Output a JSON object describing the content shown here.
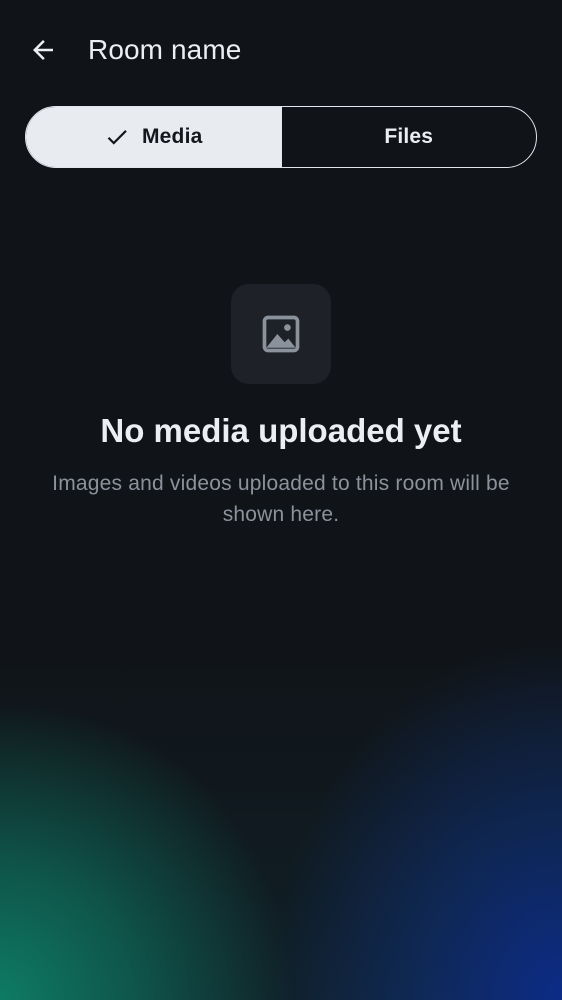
{
  "header": {
    "title": "Room name",
    "back_icon": "arrow-left-icon"
  },
  "tabs": [
    {
      "label": "Media",
      "selected": true,
      "icon": "check-icon"
    },
    {
      "label": "Files",
      "selected": false
    }
  ],
  "empty_state": {
    "icon": "image-icon",
    "title": "No media uploaded yet",
    "description": "Images and videos uploaded to this room will be shown here."
  },
  "colors": {
    "background": "#101317",
    "selected_tab_bg": "#e8ecf1",
    "text_primary": "#ebeef2",
    "text_secondary": "#8b929c",
    "icon_box_bg": "#1e2228",
    "gradient_green": "#0e8068",
    "gradient_blue": "#0c2c8c"
  }
}
